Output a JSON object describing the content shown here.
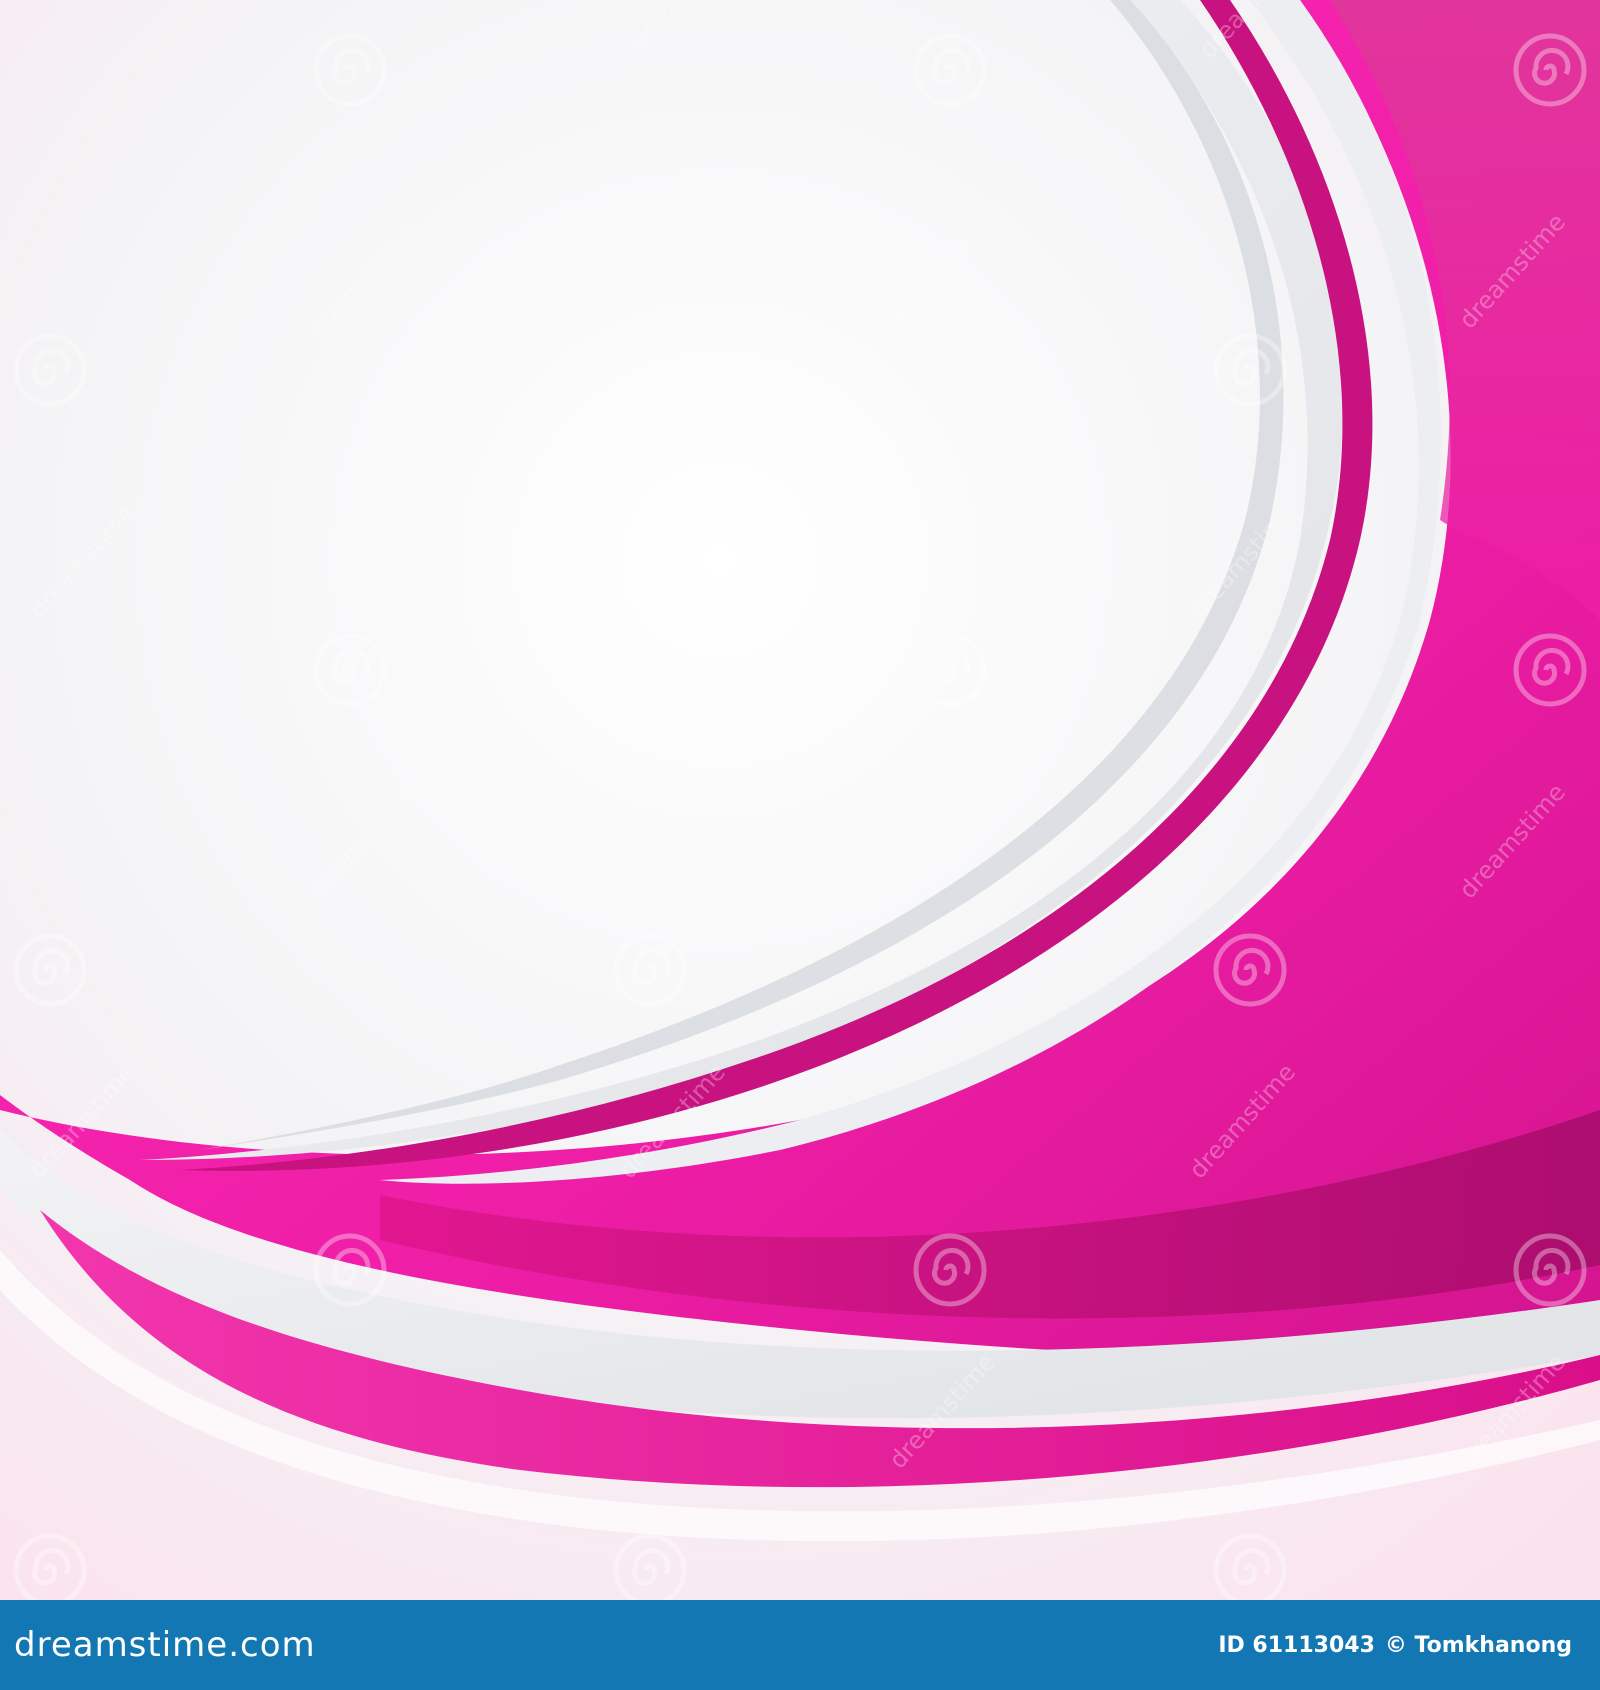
{
  "image": {
    "subject": "abstract-pink-wave-background",
    "colors": {
      "background_light": "#f6f4f6",
      "background_pink_tint": "#fbe4ee",
      "magenta_main": "#ee1ea6",
      "magenta_bright": "#ff2cb9",
      "magenta_dark": "#b30d72",
      "magenta_band_bottom": "#e2138f",
      "silver_band": "#e7e9ec",
      "footer_blue": "#1277b3"
    }
  },
  "watermark": {
    "word": "dreamstime",
    "icon": "spiral-logo-icon"
  },
  "footer": {
    "logo_text_prefix": "dreamstime",
    "logo_text_suffix": ".com",
    "id_text": "ID 61113043",
    "credit_text": "© Tomkhanong"
  }
}
